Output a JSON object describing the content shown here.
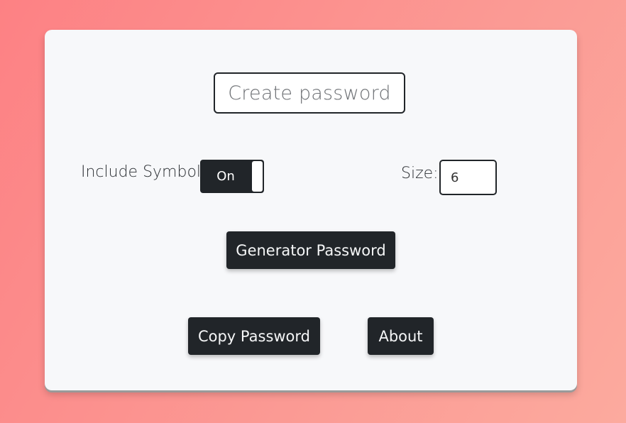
{
  "password": {
    "placeholder": "Create password"
  },
  "symbol": {
    "label": "Include Symbol:",
    "toggle_state": "On"
  },
  "size": {
    "label": "Size:",
    "value": "6"
  },
  "buttons": {
    "generate": "Generator Password",
    "copy": "Copy Password",
    "about": "About"
  },
  "colors": {
    "background_start": "#fd8184",
    "background_end": "#fcaa9e",
    "card": "#f7f8fa",
    "button": "#212529",
    "button_text": "#f5f6f7"
  }
}
